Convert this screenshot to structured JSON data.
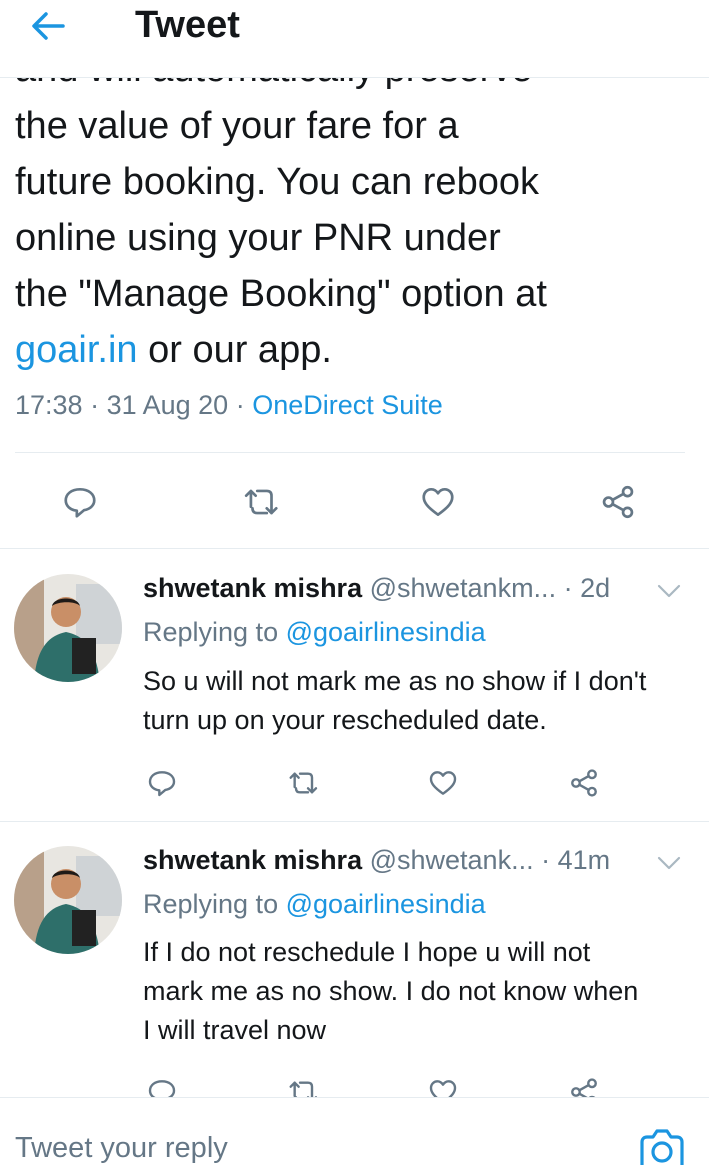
{
  "header": {
    "title": "Tweet"
  },
  "tweet": {
    "clipped_line": "and will automatically preserve",
    "line1": "the value of your fare for a",
    "line2": "future booking. You can rebook",
    "line3": "online using your PNR under",
    "line4": "the \"Manage Booking\" option at",
    "link": "goair.in",
    "line5_rest": " or our app.",
    "time": "17:38",
    "dot1": " · ",
    "date": "31 Aug 20",
    "dot2": " · ",
    "source": "OneDirect Suite"
  },
  "replies": [
    {
      "name": "shwetank mishra",
      "handle": " @shwetankm...",
      "age": " · 2d",
      "replying_prefix": "Replying to ",
      "replying_to": "@goairlinesindia",
      "text": "So u will not mark me as no show if I don't turn up on your rescheduled date."
    },
    {
      "name": "shwetank mishra",
      "handle": " @shwetank...",
      "age": " · 41m",
      "replying_prefix": "Replying to ",
      "replying_to": "@goairlinesindia",
      "text": "If I do not reschedule I hope u will not mark me as no show. I do not know when I will travel now"
    }
  ],
  "composer": {
    "placeholder": "Tweet your reply"
  },
  "icons": {
    "back": "arrow-left-icon",
    "reply": "comment-icon",
    "retweet": "retweet-icon",
    "like": "heart-icon",
    "share": "share-icon",
    "more": "chevron-down-icon",
    "camera": "camera-icon"
  },
  "colors": {
    "accent": "#1b95e0",
    "text": "#14171a",
    "muted": "#657786",
    "divider": "#e6ecf0"
  }
}
